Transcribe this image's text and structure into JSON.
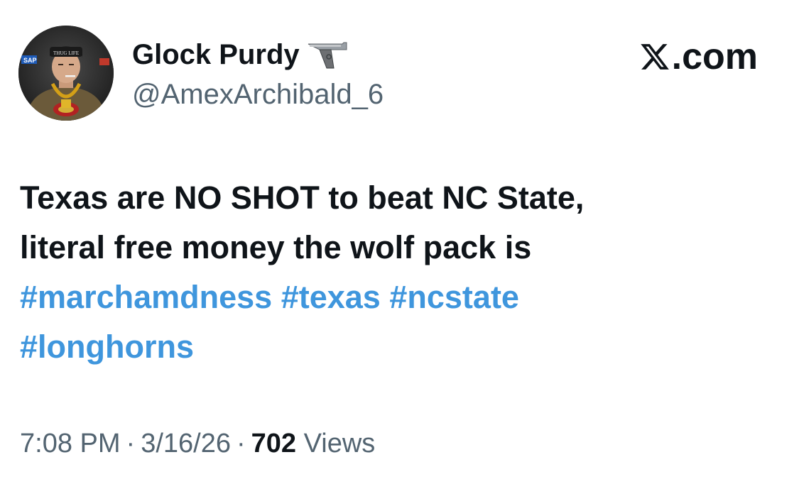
{
  "author": {
    "display_name": "Glock Purdy",
    "handle": "@AmexArchibald_6",
    "avatar_cap_text": "THUG LIFE",
    "avatar_sponsor_text": "SAP"
  },
  "brand": {
    "logo_icon": "x-logo-icon",
    "suffix": ".com"
  },
  "tweet": {
    "line1": "Texas are NO SHOT to beat NC State,",
    "line2": "literal free money the wolf pack is",
    "hashtags": [
      "#marchamdness",
      "#texas",
      "#ncstate",
      "#longhorns"
    ]
  },
  "meta": {
    "time": "7:08 PM",
    "separator": "·",
    "date": "3/16/26",
    "views_count": "702",
    "views_label": "Views"
  },
  "colors": {
    "text": "#0f1419",
    "secondary": "#536471",
    "hashtag": "#3f96dd"
  }
}
